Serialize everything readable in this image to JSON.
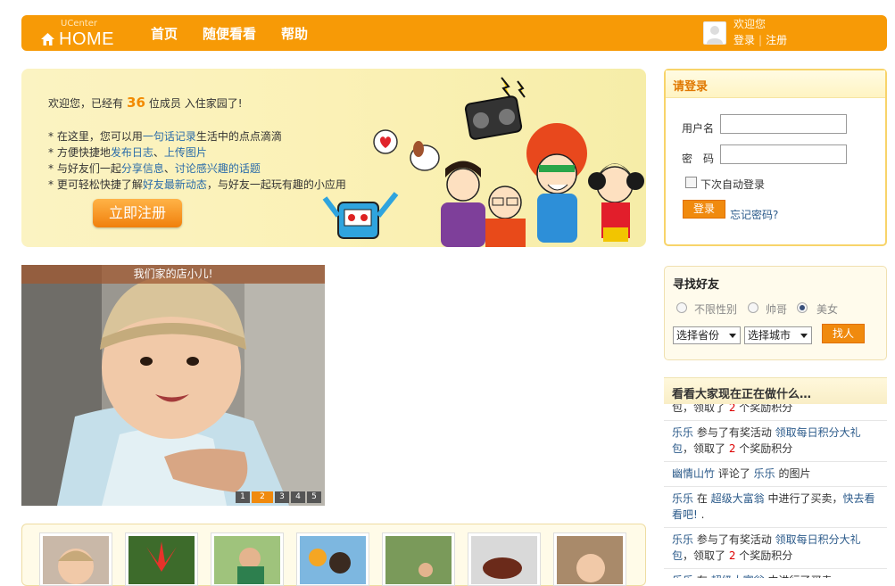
{
  "header": {
    "logo_small": "UCenter",
    "logo_big": "HOME",
    "nav": [
      "首页",
      "随便看看",
      "帮助"
    ],
    "welcome": "欢迎您",
    "login_link": "登录",
    "separator": "|",
    "register_link": "注册"
  },
  "banner": {
    "intro_prefix": "欢迎您，已经有",
    "member_count": "36",
    "intro_suffix": "位成员 入住家园了!",
    "bullets": [
      {
        "prefix": "* 在这里，您可以用",
        "link": "一句话记录",
        "suffix": "生活中的点点滴滴"
      },
      {
        "prefix": "* 方便快捷地",
        "link": "发布日志",
        "mid": "、",
        "link2": "上传图片",
        "suffix": ""
      },
      {
        "prefix": "* 与好友们一起",
        "link": "分享信息",
        "mid": "、",
        "link2": "讨论感兴趣的话题",
        "suffix": ""
      },
      {
        "prefix": "* 更可轻松快捷了解",
        "link": "好友最新动态",
        "suffix": "，与好友一起玩有趣的小应用"
      }
    ],
    "register_button": "立即注册"
  },
  "login": {
    "title": "请登录",
    "username_label": "用户名",
    "password_label": "密　码",
    "remember_label": "下次自动登录",
    "login_button": "登录",
    "forgot_link": "忘记密码?"
  },
  "find_friends": {
    "title": "寻找好友",
    "gender_options": [
      {
        "label": "不限性别",
        "selected": false
      },
      {
        "label": "帅哥",
        "selected": false
      },
      {
        "label": "美女",
        "selected": true
      }
    ],
    "province_select": "选择省份",
    "city_select": "选择城市",
    "search_button": "找人"
  },
  "feed": {
    "title": "看看大家现在正在做什么…",
    "items": [
      {
        "parts": [
          {
            "t": "包，领取了 "
          },
          {
            "t": "2",
            "c": "n"
          },
          {
            "t": " 个奖励积分"
          }
        ]
      },
      {
        "parts": [
          {
            "t": "乐乐",
            "c": "u"
          },
          {
            "t": " 参与了有奖活动 "
          },
          {
            "t": "领取每日积分大礼包",
            "c": "u"
          },
          {
            "t": "，领取了 "
          },
          {
            "t": "2",
            "c": "n"
          },
          {
            "t": " 个奖励积分"
          }
        ]
      },
      {
        "parts": [
          {
            "t": "幽情山竹",
            "c": "u"
          },
          {
            "t": " 评论了 "
          },
          {
            "t": "乐乐",
            "c": "u"
          },
          {
            "t": " 的图片"
          }
        ]
      },
      {
        "parts": [
          {
            "t": "乐乐",
            "c": "u"
          },
          {
            "t": " 在 "
          },
          {
            "t": "超级大富翁",
            "c": "u"
          },
          {
            "t": " 中进行了买卖，"
          },
          {
            "t": "快去看看吧!",
            "c": "u"
          },
          {
            "t": " ."
          }
        ]
      },
      {
        "parts": [
          {
            "t": "乐乐",
            "c": "u"
          },
          {
            "t": " 参与了有奖活动 "
          },
          {
            "t": "领取每日积分大礼包",
            "c": "u"
          },
          {
            "t": "，领取了 "
          },
          {
            "t": "2",
            "c": "n"
          },
          {
            "t": " 个奖励积分"
          }
        ]
      },
      {
        "parts": [
          {
            "t": "乐乐",
            "c": "u"
          },
          {
            "t": " 在 "
          },
          {
            "t": "超级大富翁",
            "c": "u"
          },
          {
            "t": " 中进行了买卖"
          }
        ]
      }
    ]
  },
  "slideshow": {
    "caption": "我们家的店小儿!",
    "pages": [
      "1",
      "2",
      "3",
      "4",
      "5"
    ],
    "active_page": "2"
  },
  "colors": {
    "brand_orange": "#f79a06",
    "link_blue": "#2b5a8a"
  }
}
